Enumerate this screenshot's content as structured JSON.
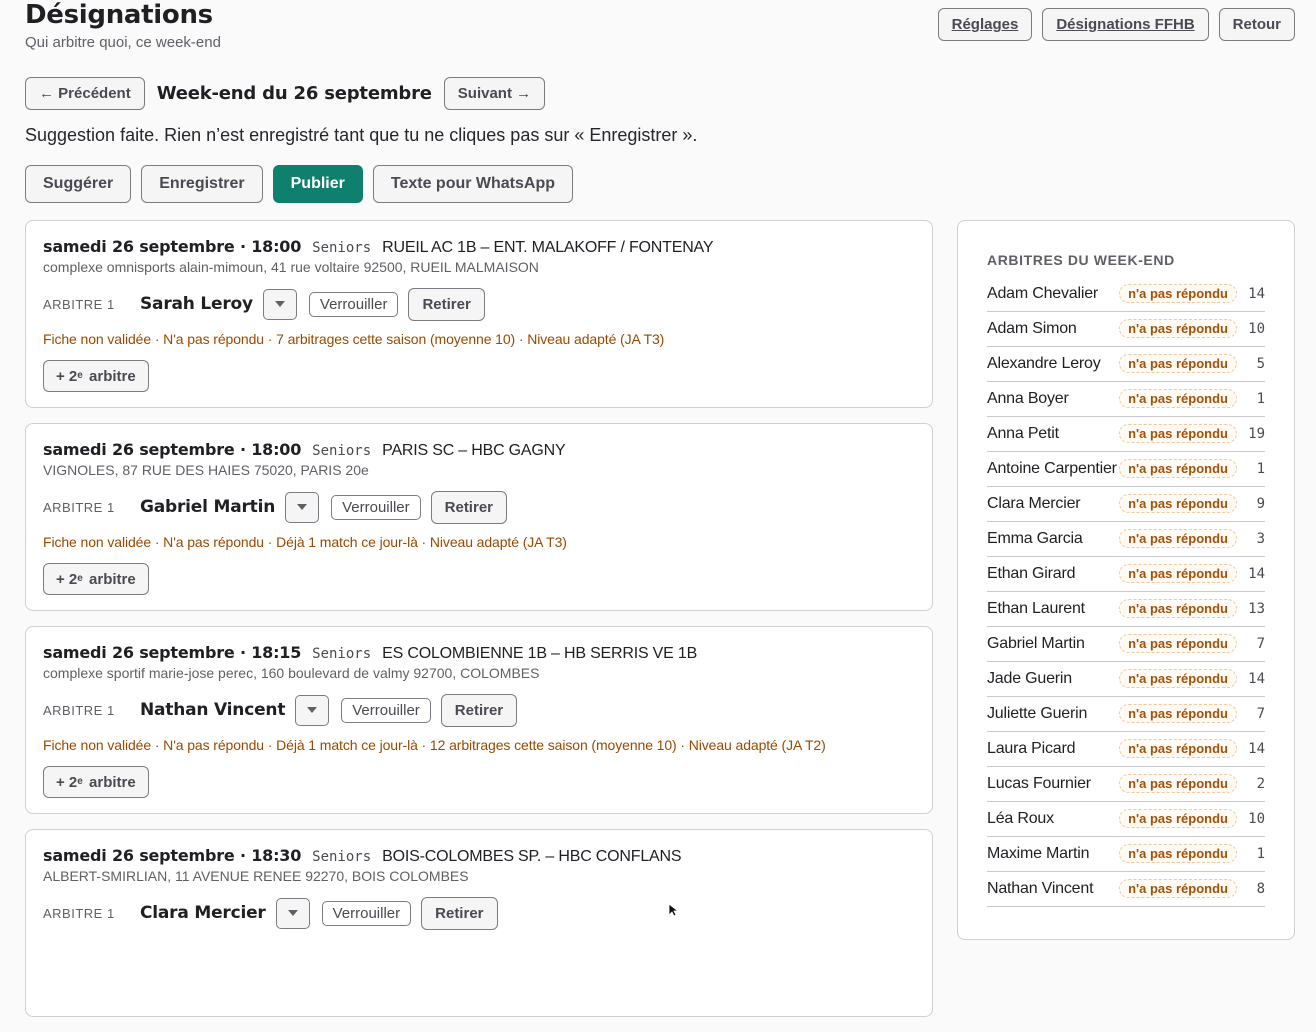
{
  "header": {
    "title": "Désignations",
    "subtitle": "Qui arbitre quoi, ce week-end"
  },
  "top_actions": {
    "settings_label": "Réglages",
    "ffhb_label": "Désignations FFHB",
    "back_label": "Retour"
  },
  "week_nav": {
    "prev_label": "← Précédent",
    "week_label": "Week-end du 26 septembre",
    "next_label": "Suivant →"
  },
  "status_message": "Suggestion faite. Rien n’est enregistré tant que tu ne cliques pas sur « Enregistrer ».",
  "actions": {
    "suggest_label": "Suggérer",
    "save_label": "Enregistrer",
    "publish_label": "Publier",
    "whatsapp_label": "Texte pour WhatsApp"
  },
  "labels": {
    "ref_slot": "ARBITRE 1",
    "lock": "Verrouiller",
    "remove": "Retirer",
    "add_ref_prefix": "+ 2",
    "add_ref_sup": "e",
    "add_ref_suffix": "arbitre"
  },
  "matches": [
    {
      "when": "samedi 26 septembre · 18:00",
      "category": "Seniors",
      "teams": "RUEIL AC 1B – ENT. MALAKOFF / FONTENAY",
      "venue": "complexe omnisports alain-mimoun, 41 rue voltaire 92500, RUEIL MALMAISON",
      "referee": "Sarah Leroy",
      "warning": "Fiche non validée · N'a pas répondu · 7 arbitrages cette saison (moyenne 10) · Niveau adapté (JA T3)"
    },
    {
      "when": "samedi 26 septembre · 18:00",
      "category": "Seniors",
      "teams": "PARIS SC – HBC GAGNY",
      "venue": "VIGNOLES, 87 RUE DES HAIES 75020, PARIS 20e",
      "referee": "Gabriel Martin",
      "warning": "Fiche non validée · N'a pas répondu · Déjà 1 match ce jour-là · Niveau adapté (JA T3)"
    },
    {
      "when": "samedi 26 septembre · 18:15",
      "category": "Seniors",
      "teams": "ES COLOMBIENNE 1B – HB SERRIS VE 1B",
      "venue": "complexe sportif marie-jose perec, 160 boulevard de valmy 92700, COLOMBES",
      "referee": "Nathan Vincent",
      "warning": "Fiche non validée · N'a pas répondu · Déjà 1 match ce jour-là · 12 arbitrages cette saison (moyenne 10) · Niveau adapté (JA T2)"
    },
    {
      "when": "samedi 26 septembre · 18:30",
      "category": "Seniors",
      "teams": "BOIS-COLOMBES SP. – HBC CONFLANS",
      "venue": "ALBERT-SMIRLIAN, 11 AVENUE RENEE 92270, BOIS COLOMBES",
      "referee": "Clara Mercier",
      "warning": ""
    }
  ],
  "sidebar": {
    "title": "ARBITRES DU WEEK-END",
    "badge_label": "n'a pas répondu",
    "referees": [
      {
        "name": "Adam Chevalier",
        "count": "14"
      },
      {
        "name": "Adam Simon",
        "count": "10"
      },
      {
        "name": "Alexandre Leroy",
        "count": "5"
      },
      {
        "name": "Anna Boyer",
        "count": "1"
      },
      {
        "name": "Anna Petit",
        "count": "19"
      },
      {
        "name": "Antoine Carpentier",
        "count": "1"
      },
      {
        "name": "Clara Mercier",
        "count": "9"
      },
      {
        "name": "Emma Garcia",
        "count": "3"
      },
      {
        "name": "Ethan Girard",
        "count": "14"
      },
      {
        "name": "Ethan Laurent",
        "count": "13"
      },
      {
        "name": "Gabriel Martin",
        "count": "7"
      },
      {
        "name": "Jade Guerin",
        "count": "14"
      },
      {
        "name": "Juliette Guerin",
        "count": "7"
      },
      {
        "name": "Laura Picard",
        "count": "14"
      },
      {
        "name": "Lucas Fournier",
        "count": "2"
      },
      {
        "name": "Léa Roux",
        "count": "10"
      },
      {
        "name": "Maxime Martin",
        "count": "1"
      },
      {
        "name": "Nathan Vincent",
        "count": "8"
      }
    ]
  },
  "colors": {
    "primary": "#0f7f6e",
    "warning_text": "#9a4a00",
    "badge_text": "#a0510a"
  }
}
